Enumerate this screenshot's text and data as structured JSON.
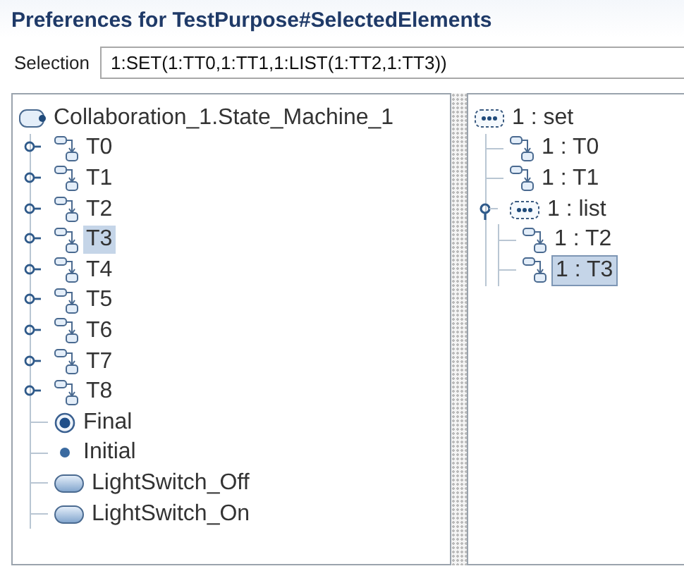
{
  "title": "Preferences for TestPurpose#SelectedElements",
  "selection": {
    "label": "Selection",
    "value": "1:SET(1:TT0,1:TT1,1:LIST(1:TT2,1:TT3))"
  },
  "left_tree": {
    "root": {
      "label": "Collaboration_1.State_Machine_1",
      "kind": "state_machine",
      "selected": false,
      "children": [
        {
          "label": "T0",
          "kind": "transition",
          "expanded": false,
          "selected": false
        },
        {
          "label": "T1",
          "kind": "transition",
          "expanded": false,
          "selected": false
        },
        {
          "label": "T2",
          "kind": "transition",
          "expanded": false,
          "selected": false
        },
        {
          "label": "T3",
          "kind": "transition",
          "expanded": false,
          "selected": true
        },
        {
          "label": "T4",
          "kind": "transition",
          "expanded": false,
          "selected": false
        },
        {
          "label": "T5",
          "kind": "transition",
          "expanded": false,
          "selected": false
        },
        {
          "label": "T6",
          "kind": "transition",
          "expanded": false,
          "selected": false
        },
        {
          "label": "T7",
          "kind": "transition",
          "expanded": false,
          "selected": false
        },
        {
          "label": "T8",
          "kind": "transition",
          "expanded": false,
          "selected": false
        },
        {
          "label": "Final",
          "kind": "final",
          "selected": false
        },
        {
          "label": "Initial",
          "kind": "initial",
          "selected": false
        },
        {
          "label": "LightSwitch_Off",
          "kind": "state",
          "selected": false
        },
        {
          "label": "LightSwitch_On",
          "kind": "state",
          "selected": false
        }
      ]
    }
  },
  "right_tree": {
    "root": {
      "label": "1 : set",
      "kind": "group",
      "selected": false,
      "children": [
        {
          "label": "1 : T0",
          "kind": "transition",
          "selected": false
        },
        {
          "label": "1 : T1",
          "kind": "transition",
          "selected": false
        },
        {
          "label": "1 : list",
          "kind": "group",
          "expanded": true,
          "selected": false,
          "children": [
            {
              "label": "1 : T2",
              "kind": "transition",
              "selected": false
            },
            {
              "label": "1 : T3",
              "kind": "transition",
              "selected": true
            }
          ]
        }
      ]
    }
  }
}
